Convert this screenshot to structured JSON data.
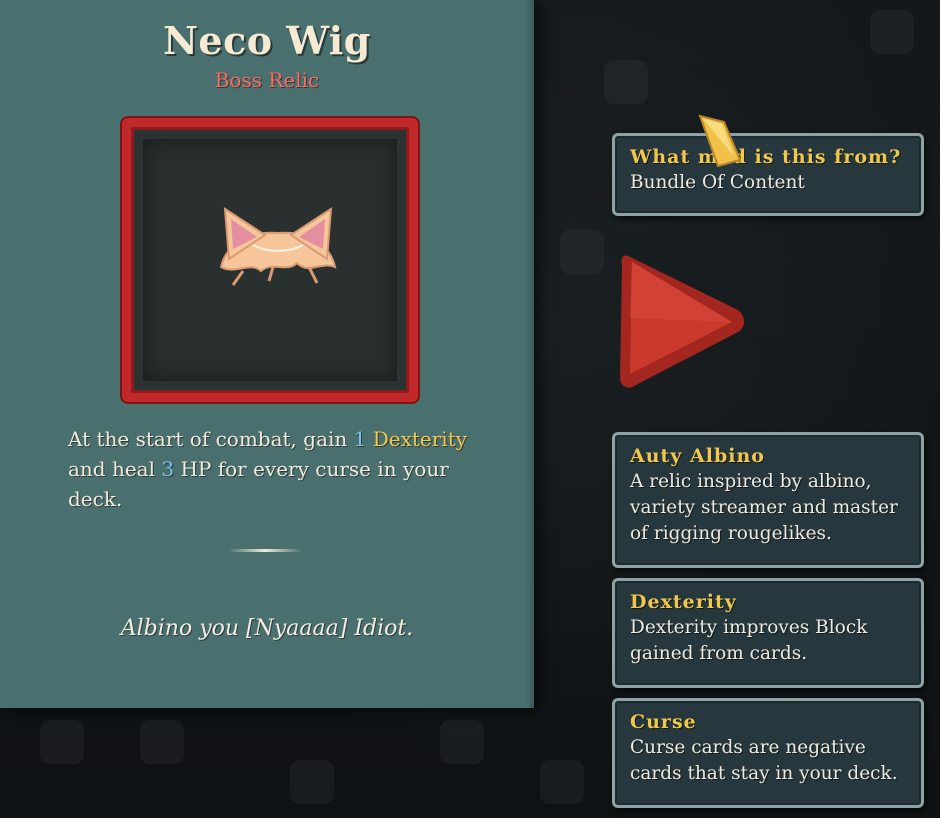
{
  "relic": {
    "name": "Neco Wig",
    "tier": "Boss Relic",
    "description": {
      "p1": "At the start of combat, gain ",
      "n1": "1",
      "kw1": "Dexterity",
      "p2": " and heal ",
      "n2": "3",
      "p3": " HP for every curse in your deck."
    },
    "flavor": "Albino you [Nyaaaa] Idiot."
  },
  "tooltips": [
    {
      "title": "What mod is this from?",
      "body": "Bundle Of Content"
    },
    {
      "title": "Auty Albino",
      "body": "A relic inspired by albino, variety streamer and master of rigging rougelikes."
    },
    {
      "title": "Dexterity",
      "body": "Dexterity improves Block gained from cards."
    },
    {
      "title": "Curse",
      "body": "Curse cards are negative cards that stay in your deck."
    }
  ],
  "icons": {
    "relic_image": "cat-ear-wig-icon",
    "next": "next-arrow-icon",
    "cursor": "cursor-icon"
  },
  "colors": {
    "panel": "#4a6f6f",
    "frame": "#c0282a",
    "keyword": "#f3c84a",
    "number": "#79c3ee",
    "tier": "#ff6a5e",
    "tooltip_title": "#f2c84b"
  }
}
